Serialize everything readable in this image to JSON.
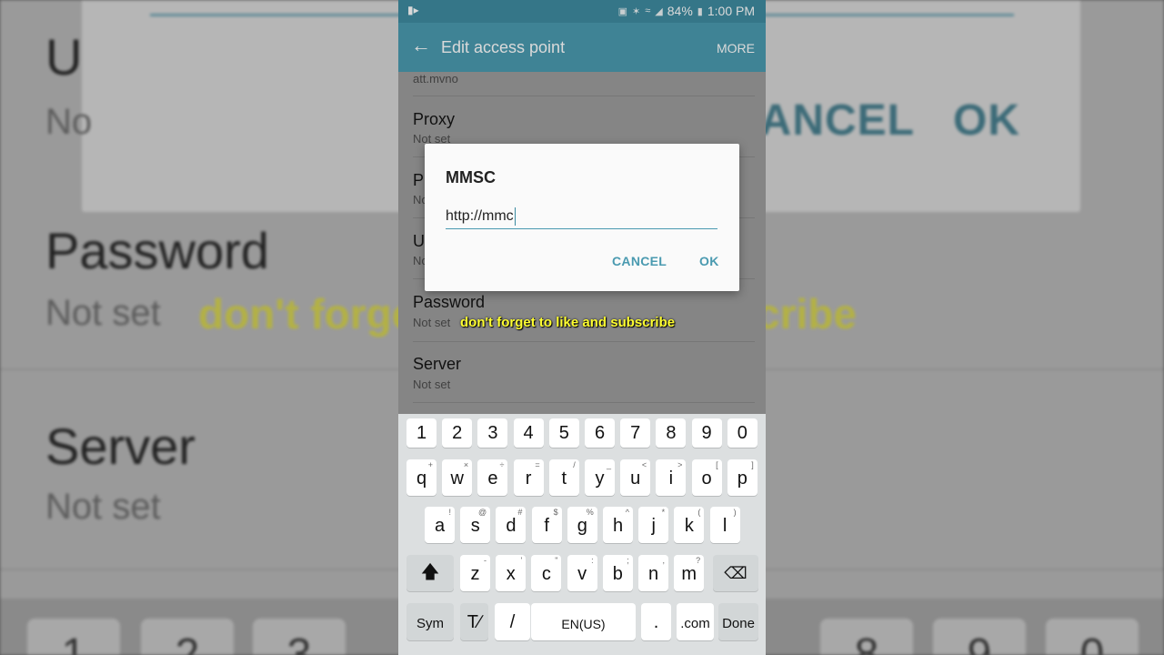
{
  "background": {
    "top_buttons": [
      "CANCEL",
      "OK"
    ],
    "items": [
      {
        "title": "U",
        "subtitle": "No"
      },
      {
        "title": "Password",
        "subtitle": "Not set"
      },
      {
        "title": "Server",
        "subtitle": "Not set"
      }
    ],
    "subscribe_text": "don't forget to like and subscribe",
    "key_glyphs": [
      "1",
      "2",
      "3",
      "8",
      "9",
      "0"
    ]
  },
  "status_bar": {
    "battery": "84%",
    "time": "1:00 PM"
  },
  "app_bar": {
    "title": "Edit access point",
    "more_label": "MORE"
  },
  "list": [
    {
      "title": "",
      "subtitle": "att.mvno"
    },
    {
      "title": "Proxy",
      "subtitle": "Not set"
    },
    {
      "title": "P",
      "subtitle": "No"
    },
    {
      "title": "U",
      "subtitle": "No"
    },
    {
      "title": "Password",
      "subtitle": "Not set"
    },
    {
      "title": "Server",
      "subtitle": "Not set"
    }
  ],
  "dialog": {
    "title": "MMSC",
    "input_value": "http://mmc",
    "cancel_label": "CANCEL",
    "ok_label": "OK"
  },
  "overlay_caption": "don't forget to like and subscribe",
  "keyboard": {
    "numbers": [
      "1",
      "2",
      "3",
      "4",
      "5",
      "6",
      "7",
      "8",
      "9",
      "0"
    ],
    "row1": [
      {
        "k": "q",
        "a": "+"
      },
      {
        "k": "w",
        "a": "×"
      },
      {
        "k": "e",
        "a": "÷"
      },
      {
        "k": "r",
        "a": "="
      },
      {
        "k": "t",
        "a": "/"
      },
      {
        "k": "y",
        "a": "_"
      },
      {
        "k": "u",
        "a": "<"
      },
      {
        "k": "i",
        "a": ">"
      },
      {
        "k": "o",
        "a": "["
      },
      {
        "k": "p",
        "a": "]"
      }
    ],
    "row2": [
      {
        "k": "a",
        "a": "!"
      },
      {
        "k": "s",
        "a": "@"
      },
      {
        "k": "d",
        "a": "#"
      },
      {
        "k": "f",
        "a": "$"
      },
      {
        "k": "g",
        "a": "%"
      },
      {
        "k": "h",
        "a": "^"
      },
      {
        "k": "j",
        "a": "*"
      },
      {
        "k": "k",
        "a": "("
      },
      {
        "k": "l",
        "a": ")"
      }
    ],
    "row3": [
      {
        "k": "z",
        "a": "-"
      },
      {
        "k": "x",
        "a": "'"
      },
      {
        "k": "c",
        "a": "\""
      },
      {
        "k": "v",
        "a": ":"
      },
      {
        "k": "b",
        "a": ";"
      },
      {
        "k": "n",
        "a": ","
      },
      {
        "k": "m",
        "a": "?"
      }
    ],
    "sym_label": "Sym",
    "slash_label": "/",
    "space_label": "EN(US)",
    "period_label": ".",
    "com_label": ".com",
    "done_label": "Done"
  },
  "colors": {
    "accent": "#4a9ab0",
    "status_bar": "#3f8ba0",
    "caption": "#ffff30"
  }
}
